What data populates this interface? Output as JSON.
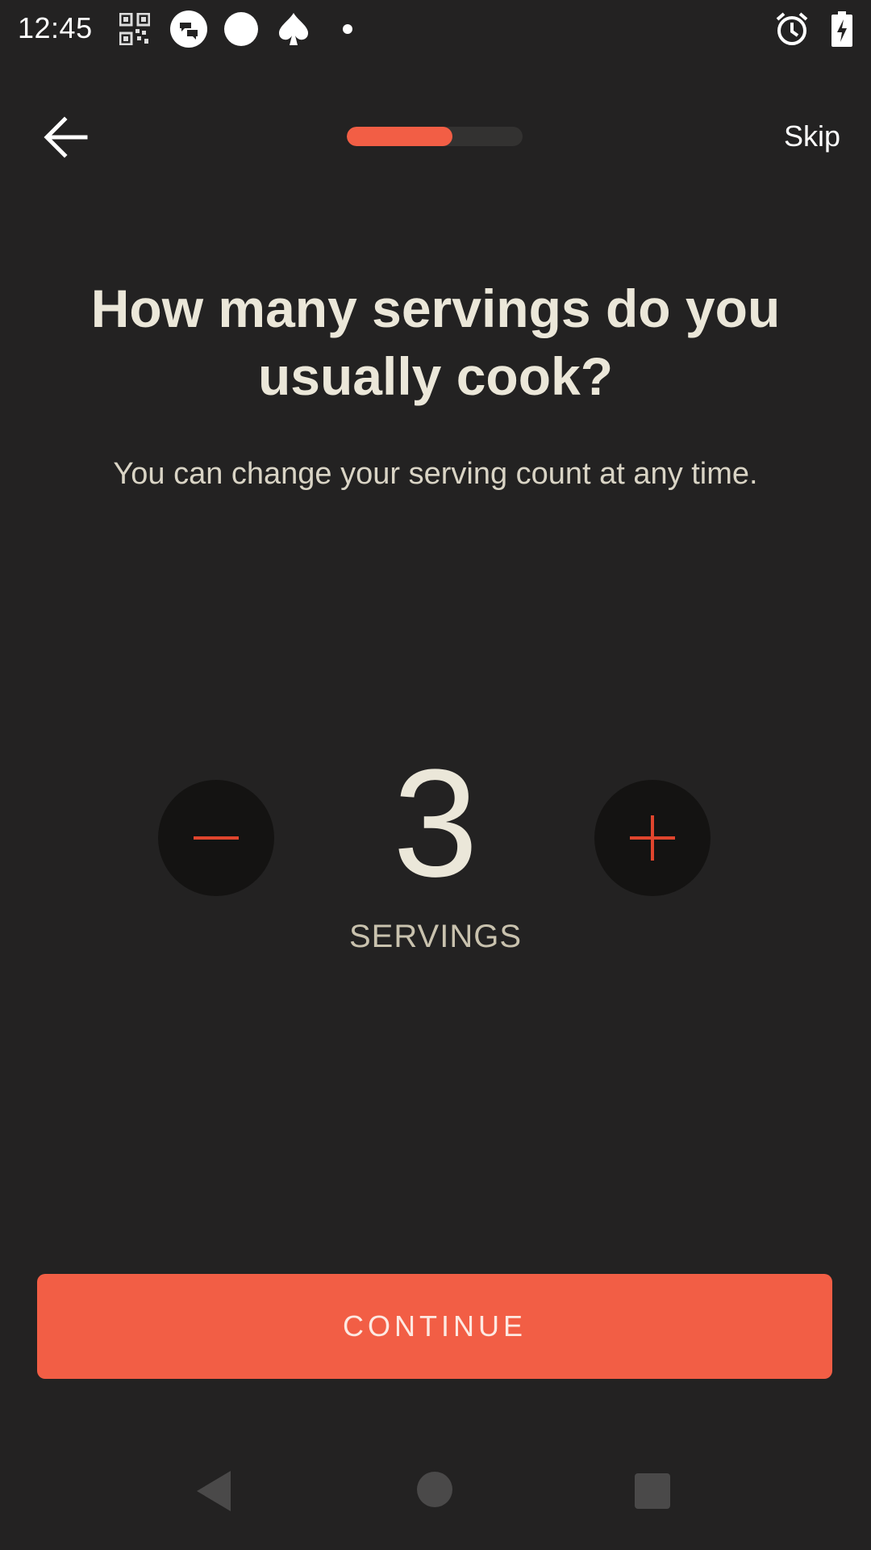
{
  "status_bar": {
    "time": "12:45",
    "left_icons": [
      "qr-code-icon",
      "chat-bubble-icon",
      "circle-icon",
      "spade-icon",
      "dot-icon"
    ],
    "right_icons": [
      "alarm-icon",
      "battery-charging-icon"
    ]
  },
  "topbar": {
    "back_icon": "arrow-left-icon",
    "progress": 0.6,
    "skip_label": "Skip"
  },
  "main": {
    "title": "How many servings do you usually cook?",
    "subtitle": "You can change your serving count at any time.",
    "servings_count": "3",
    "servings_label": "SERVINGS",
    "decrement_icon": "minus-icon",
    "increment_icon": "plus-icon"
  },
  "footer": {
    "continue_label": "CONTINUE"
  },
  "nav_bar": {
    "icons": [
      "back-triangle-icon",
      "home-circle-icon",
      "recents-square-icon"
    ]
  },
  "colors": {
    "background": "#232222",
    "accent": "#f25e45",
    "text_primary": "#ebe7d9",
    "stepper_bg": "#141312"
  }
}
